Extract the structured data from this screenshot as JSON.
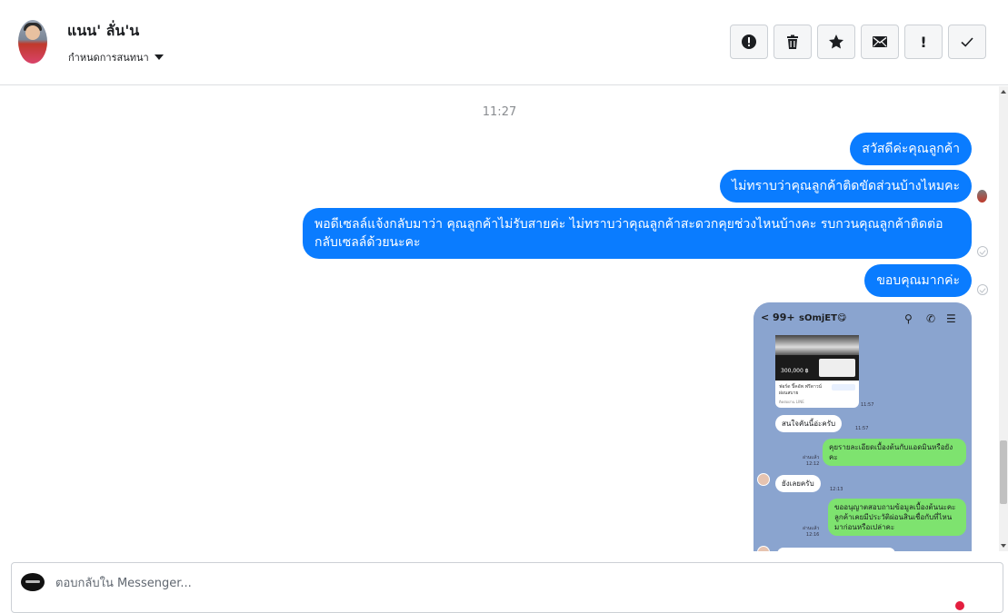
{
  "header": {
    "contact_name": "แนน' ลั่น'น",
    "assign_label": "กำหนดการสนทนา",
    "actions": [
      "alert-circle-icon",
      "trash-icon",
      "star-icon",
      "envelope-icon",
      "exclamation-icon",
      "check-icon"
    ],
    "exclamation_label": "!"
  },
  "thread": {
    "timestamp": "11:27",
    "messages": [
      {
        "text": "สวัสดีค่ะคุณลูกค้า",
        "sender": "page"
      },
      {
        "text": "ไม่ทราบว่าคุณลูกค้าติดขัดส่วนบ้างไหมคะ",
        "sender": "page"
      },
      {
        "text": "พอดีเซลล์แจ้งกลับมาว่า คุณลูกค้าไม่รับสายค่ะ ไม่ทราบว่าคุณลูกค้าสะดวกคุยช่วงไหนบ้างคะ รบกวนคุณลูกค้าติดต่อกลับเซลล์ด้วยนะคะ",
        "sender": "page"
      },
      {
        "text": "ขอบคุณมากค่ะ",
        "sender": "page"
      }
    ],
    "attachment": {
      "header": {
        "back": "< 99+",
        "chat_name": "sOmjET😋",
        "icons": [
          "search-icon",
          "phone-icon",
          "menu-icon"
        ]
      },
      "card": {
        "price": "300,000 ฿",
        "text": "ฟอร์ด ปิ๊คอัพ ฟรีดาวน์ ผ่อนสบาย",
        "footer": "ติดต่อผ่าน LINE"
      },
      "times": {
        "t1": "11:57",
        "t2": "11:57",
        "t3": "12:13",
        "t4": "12:16"
      },
      "reads": {
        "r1": "อ่านแล้ว\n12:12",
        "r2": "อ่านแล้ว\n12:16"
      },
      "bubbles": {
        "b1": "สนใจคันนี้อ่ะครับ",
        "b2": "คุยรายละเอียดเบื้องต้นกับแอดมินหรือยังคะ",
        "b3": "ยังเลยครับ",
        "b4": "ขออนุญาตสอบถามข้อมูลเบื้องต้นนะคะลูกค้าเคยมีประวัติผ่อนสินเชื่อกับที่ไหนมาก่อนหรือเปล่าคะ"
      }
    }
  },
  "composer": {
    "placeholder": "ตอบกลับใน Messenger..."
  },
  "colors": {
    "bubble": "#0a7cff",
    "line_bg": "#8aa4cf",
    "line_green": "#7ee36f"
  }
}
